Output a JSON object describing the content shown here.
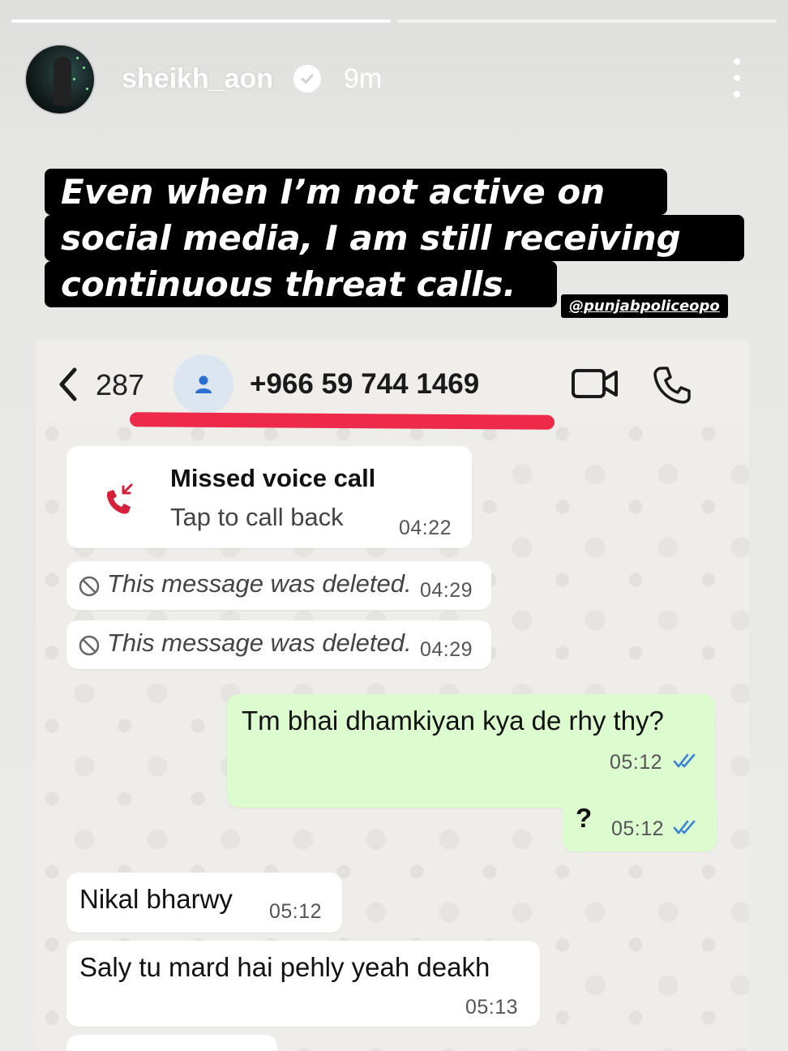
{
  "story": {
    "progress": [
      1.0,
      0.0
    ],
    "username": "sheikh_aon",
    "time_ago": "9m",
    "caption_lines": [
      "Even when I’m not active on",
      "social media, I am still receiving",
      "continuous threat calls."
    ],
    "handle": "@punjabpoliceopo"
  },
  "chat": {
    "back_count": "287",
    "contact_number": "+966 59 744 1469",
    "missed_call": {
      "title": "Missed voice call",
      "subtitle": "Tap to call back",
      "time": "04:22"
    },
    "messages": [
      {
        "direction": "in",
        "deleted": true,
        "text": "This message was deleted.",
        "time": "04:29"
      },
      {
        "direction": "in",
        "deleted": true,
        "text": "This message was deleted.",
        "time": "04:29"
      },
      {
        "direction": "out",
        "text": "Tm bhai dhamkiyan kya de rhy thy?",
        "time": "05:12",
        "status": "read"
      },
      {
        "direction": "out",
        "text": "?",
        "time": "05:12",
        "status": "read"
      },
      {
        "direction": "in",
        "text": "Nikal bharwy",
        "time": "05:12"
      },
      {
        "direction": "in",
        "text": "Saly tu mard hai pehly yeah deakh",
        "time": "05:13"
      }
    ]
  },
  "colors": {
    "outgoing_bubble": "#dcfcd0",
    "incoming_bubble": "#ffffff",
    "read_ticks": "#3b82d6",
    "annotation_underline": "#ee2a4b",
    "missed_call_icon": "#d6203a"
  },
  "icons": [
    "verified-badge-icon",
    "more-options-icon",
    "back-chevron-icon",
    "contact-person-icon",
    "video-call-icon",
    "phone-call-icon",
    "missed-call-icon",
    "deleted-message-icon",
    "double-check-icon"
  ]
}
